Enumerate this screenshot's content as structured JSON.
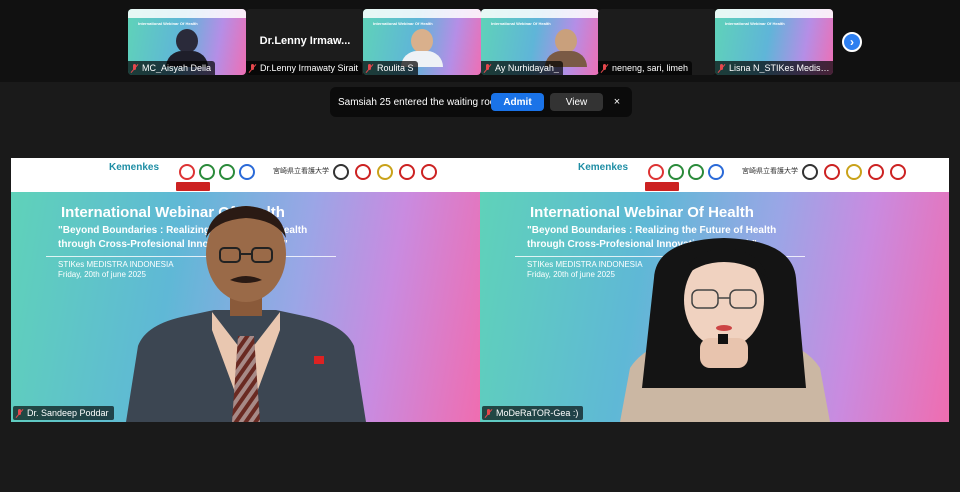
{
  "participants_strip": [
    {
      "name": "MC_Aisyah Della",
      "video": true
    },
    {
      "name": "Dr.Lenny Irmawaty Sirait",
      "display_name": "Dr.Lenny  Irmaw...",
      "video": false
    },
    {
      "name": "Roulita S",
      "video": true
    },
    {
      "name": "Ay Nurhidayah_",
      "video": true
    },
    {
      "name": "neneng, sari, limeh",
      "video": false
    },
    {
      "name": "Lisna N_STIKes Medistra...",
      "video": true
    }
  ],
  "thumb_title": "International Webinar Of Health",
  "notification": {
    "message": "Samsiah 25 entered the waiting room",
    "admit_label": "Admit",
    "view_label": "View",
    "close_glyph": "×"
  },
  "next_glyph": "›",
  "webinar": {
    "brand": "Kemenkes",
    "title": "International Webinar Of Health",
    "subtitle_line1": "\"Beyond Boundaries : Realizing the Future of Health",
    "subtitle_line2": "through Cross-Profesional Innovation in Health\"",
    "institution": "STIKes MEDISTRA INDONESIA",
    "date": "Friday, 20th of june 2025",
    "jp_text": "宮崎県立看護大学"
  },
  "main_tiles": [
    {
      "name": "Dr. Sandeep Poddar"
    },
    {
      "name": "MoDeRaTOR-Gea :)"
    }
  ],
  "colors": {
    "accent": "#1a73e8",
    "mic_off": "#e5484d",
    "background": "#1a1a1a"
  }
}
